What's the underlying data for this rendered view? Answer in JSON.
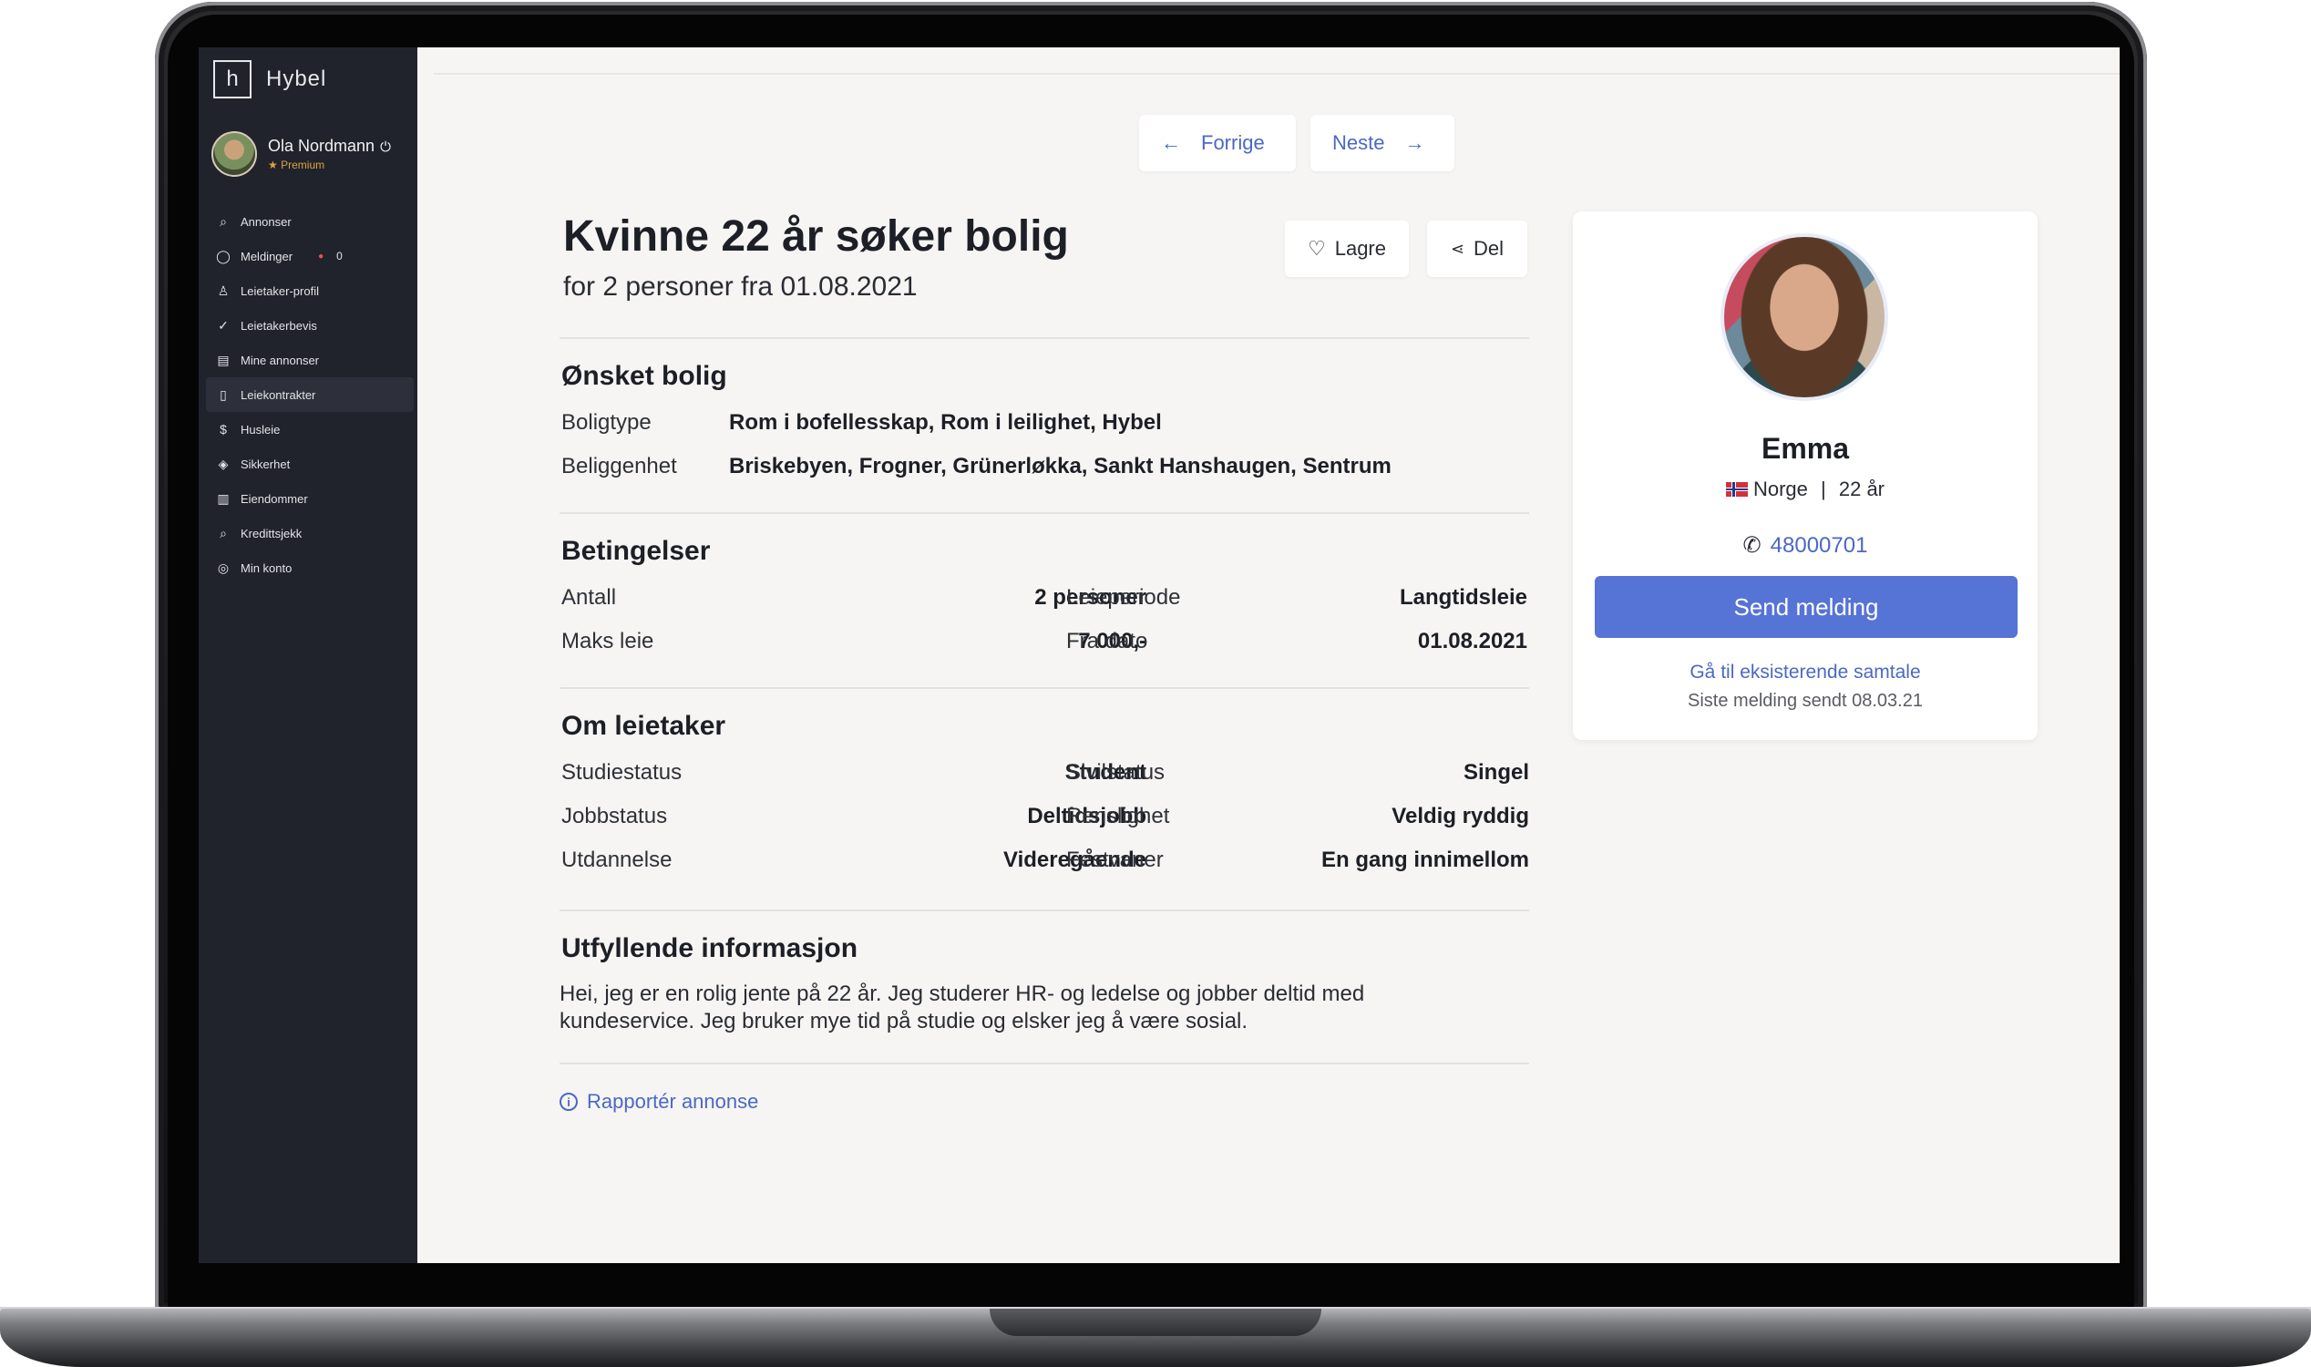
{
  "app": {
    "name": "Hybel",
    "logo_glyph": "h"
  },
  "user": {
    "name": "Ola Nordmann",
    "tier": "Premium"
  },
  "sidebar": {
    "items": [
      {
        "label": "Annonser",
        "icon": "search-icon",
        "glyph": "⌕"
      },
      {
        "label": "Meldinger",
        "icon": "chat-icon",
        "glyph": "◯",
        "count": "0"
      },
      {
        "label": "Leietaker-profil",
        "icon": "user-icon",
        "glyph": "♙"
      },
      {
        "label": "Leietakerbevis",
        "icon": "check-circle-icon",
        "glyph": "✓"
      },
      {
        "label": "Mine annonser",
        "icon": "list-icon",
        "glyph": "▤"
      },
      {
        "label": "Leiekontrakter",
        "icon": "document-icon",
        "glyph": "▯"
      },
      {
        "label": "Husleie",
        "icon": "dollar-icon",
        "glyph": "$"
      },
      {
        "label": "Sikkerhet",
        "icon": "shield-icon",
        "glyph": "◈"
      },
      {
        "label": "Eiendommer",
        "icon": "building-icon",
        "glyph": "▥"
      },
      {
        "label": "Kredittsjekk",
        "icon": "magnifier-icon",
        "glyph": "⌕"
      },
      {
        "label": "Min konto",
        "icon": "account-icon",
        "glyph": "◎"
      }
    ],
    "active_index": 5
  },
  "pager": {
    "prev": "Forrige",
    "next": "Neste"
  },
  "listing": {
    "title": "Kvinne 22 år søker bolig",
    "subtitle": "for 2 personer fra 01.08.2021",
    "save_label": "Lagre",
    "share_label": "Del"
  },
  "sections": {
    "housing": {
      "heading": "Ønsket bolig",
      "type_label": "Boligtype",
      "type_value": "Rom i bofellesskap, Rom i leilighet, Hybel",
      "location_label": "Beliggenhet",
      "location_value": "Briskebyen, Frogner, Grünerløkka, Sankt Hanshaugen, Sentrum"
    },
    "conditions": {
      "heading": "Betingelser",
      "rows": [
        {
          "l1": "Antall",
          "v1": "2 personer",
          "l2": "Leieperiode",
          "v2": "Langtidsleie"
        },
        {
          "l1": "Maks leie",
          "v1": "7 000,-",
          "l2": "Fra dato",
          "v2": "01.08.2021"
        }
      ]
    },
    "tenant": {
      "heading": "Om leietaker",
      "rows": [
        {
          "l1": "Studiestatus",
          "v1": "Student",
          "l2": "Sivilstatus",
          "v2": "Singel"
        },
        {
          "l1": "Jobbstatus",
          "v1": "Deltidsjobb",
          "l2": "Renslighet",
          "v2": "Veldig ryddig"
        },
        {
          "l1": "Utdannelse",
          "v1": "Videregående",
          "l2": "Festvaner",
          "v2": "En gang innimellom"
        }
      ]
    },
    "info": {
      "heading": "Utfyllende informasjon",
      "text": "Hei, jeg er en rolig jente på 22 år. Jeg studerer HR- og ledelse og jobber deltid med kundeservice. Jeg bruker mye tid på studie og elsker jeg å være sosial."
    }
  },
  "report_label": "Rapportér annonse",
  "card": {
    "name": "Emma",
    "country": "Norge",
    "age": "22 år",
    "separator": "|",
    "phone": "48000701",
    "send_label": "Send melding",
    "existing_link": "Gå til eksisterende samtale",
    "last_message": "Siste melding sendt 08.03.21"
  },
  "colors": {
    "accent": "#5673d6",
    "link": "#4b68c4",
    "sidebar": "#21232c",
    "premium": "#d9a441"
  }
}
